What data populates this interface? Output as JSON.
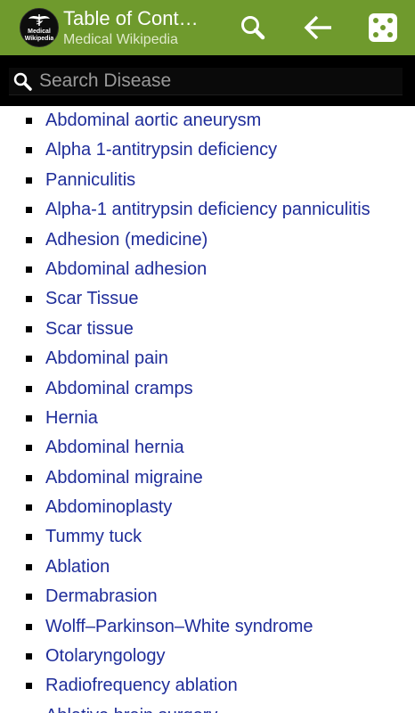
{
  "appbar": {
    "title": "Table of Cont…",
    "subtitle": "Medical Wikipedia",
    "logo_text_top": "Medical",
    "logo_text_bottom": "Wikipedia",
    "bg_color": "#6f9a2d",
    "actions": [
      {
        "name": "search-icon"
      },
      {
        "name": "back-arrow-icon"
      },
      {
        "name": "random-dice-icon"
      }
    ]
  },
  "search": {
    "placeholder": "Search Disease",
    "value": ""
  },
  "toc": {
    "link_color": "#1f2d9a",
    "items": [
      "Abdominal aortic aneurysm",
      "Alpha 1-antitrypsin deficiency",
      "Panniculitis",
      "Alpha-1 antitrypsin deficiency panniculitis",
      "Adhesion (medicine)",
      "Abdominal adhesion",
      "Scar Tissue",
      "Scar tissue",
      "Abdominal pain",
      "Abdominal cramps",
      "Hernia",
      "Abdominal hernia",
      "Abdominal migraine",
      "Abdominoplasty",
      "Tummy tuck",
      "Ablation",
      "Dermabrasion",
      "Wolff–Parkinson–White syndrome",
      "Otolaryngology",
      "Radiofrequency ablation",
      "Ablative brain surgery"
    ]
  }
}
